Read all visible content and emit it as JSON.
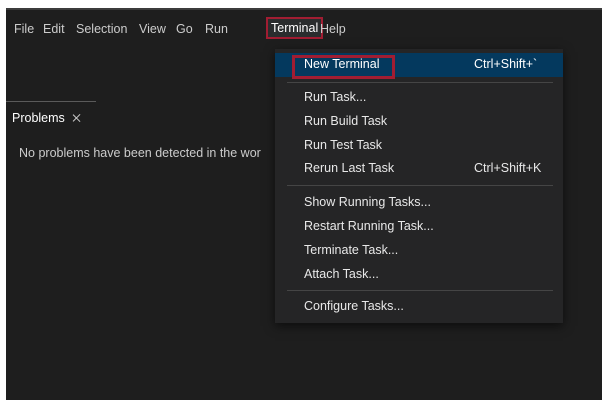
{
  "menubar": {
    "items": [
      "File",
      "Edit",
      "Selection",
      "View",
      "Go",
      "Run",
      "Terminal",
      "Help"
    ],
    "active": "Terminal"
  },
  "panel": {
    "tab_label": "Problems",
    "close_icon": "close-icon",
    "message": "No problems have been detected in the wor"
  },
  "terminal_menu": {
    "new_terminal": {
      "label": "New Terminal",
      "shortcut": "Ctrl+Shift+`"
    },
    "run_task": "Run Task...",
    "run_build_task": "Run Build Task",
    "run_test_task": "Run Test Task",
    "rerun_last_task": {
      "label": "Rerun Last Task",
      "shortcut": "Ctrl+Shift+K"
    },
    "show_running_tasks": "Show Running Tasks...",
    "restart_running_task": "Restart Running Task...",
    "terminate_task": "Terminate Task...",
    "attach_task": "Attach Task...",
    "configure_tasks": "Configure Tasks..."
  },
  "colors": {
    "background": "#1e1e1e",
    "menu_background": "#252526",
    "selection": "#04395e",
    "highlight_outline": "#a11d32"
  }
}
